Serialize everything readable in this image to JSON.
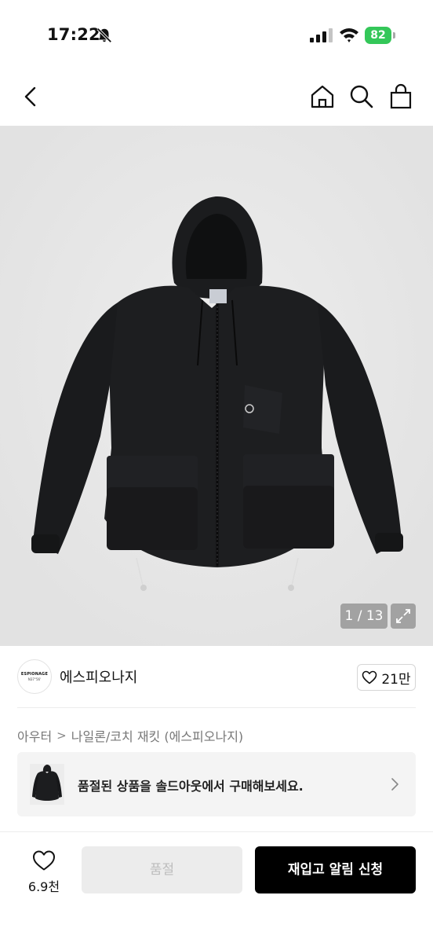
{
  "status_bar": {
    "time": "17:22",
    "battery_level": "82",
    "battery_color": "#34c759",
    "icons": [
      "bell-off-icon",
      "signal-icon",
      "wifi-icon",
      "battery-icon"
    ]
  },
  "nav": {
    "icons": [
      "chevron-left-icon",
      "home-icon",
      "search-icon",
      "shopping-bag-icon"
    ]
  },
  "gallery": {
    "counter": "1 / 13",
    "image": "black-hooded-jacket-photo",
    "expand_icon": "expand-arrows-icon"
  },
  "brand": {
    "name": "에스피오나지",
    "logo_text": "ESPIONAGE",
    "logo_subtext": "N37°56'",
    "like_count": "21만"
  },
  "breadcrumb": {
    "items": [
      "아우터",
      "나일론/코치 재킷 (에스피오나지)"
    ],
    "separator": ">"
  },
  "soldout_banner": {
    "text": "품절된 상품을 솔드아웃에서 구매해보세요."
  },
  "bottom_bar": {
    "wish_count": "6.9천",
    "soldout_label": "품절",
    "restock_label": "재입고 알림 신청"
  },
  "colors": {
    "primary_button": "#000000",
    "disabled_button": "#ececec",
    "image_background": "#e7e7e7"
  }
}
